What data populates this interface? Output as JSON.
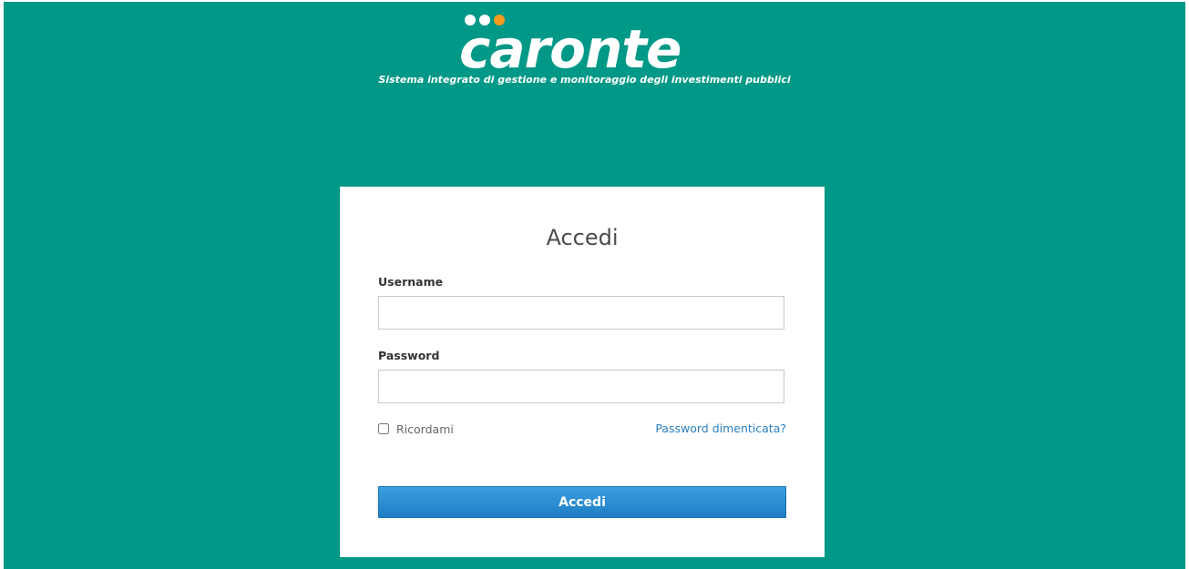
{
  "brand": {
    "name": "caronte",
    "tagline": "Sistema integrato di gestione e monitoraggio degli investimenti pubblici",
    "logo_dot_colors": [
      "#ffffff",
      "#ffffff",
      "#f39a1e"
    ]
  },
  "colors": {
    "background": "#009886",
    "card": "#ffffff",
    "primary_button": "#2589d0",
    "link": "#2a80c1"
  },
  "login": {
    "title": "Accedi",
    "username_label": "Username",
    "username_value": "",
    "password_label": "Password",
    "password_value": "",
    "remember_label": "Ricordami",
    "remember_checked": false,
    "forgot_label": "Password dimenticata?",
    "submit_label": "Accedi"
  }
}
